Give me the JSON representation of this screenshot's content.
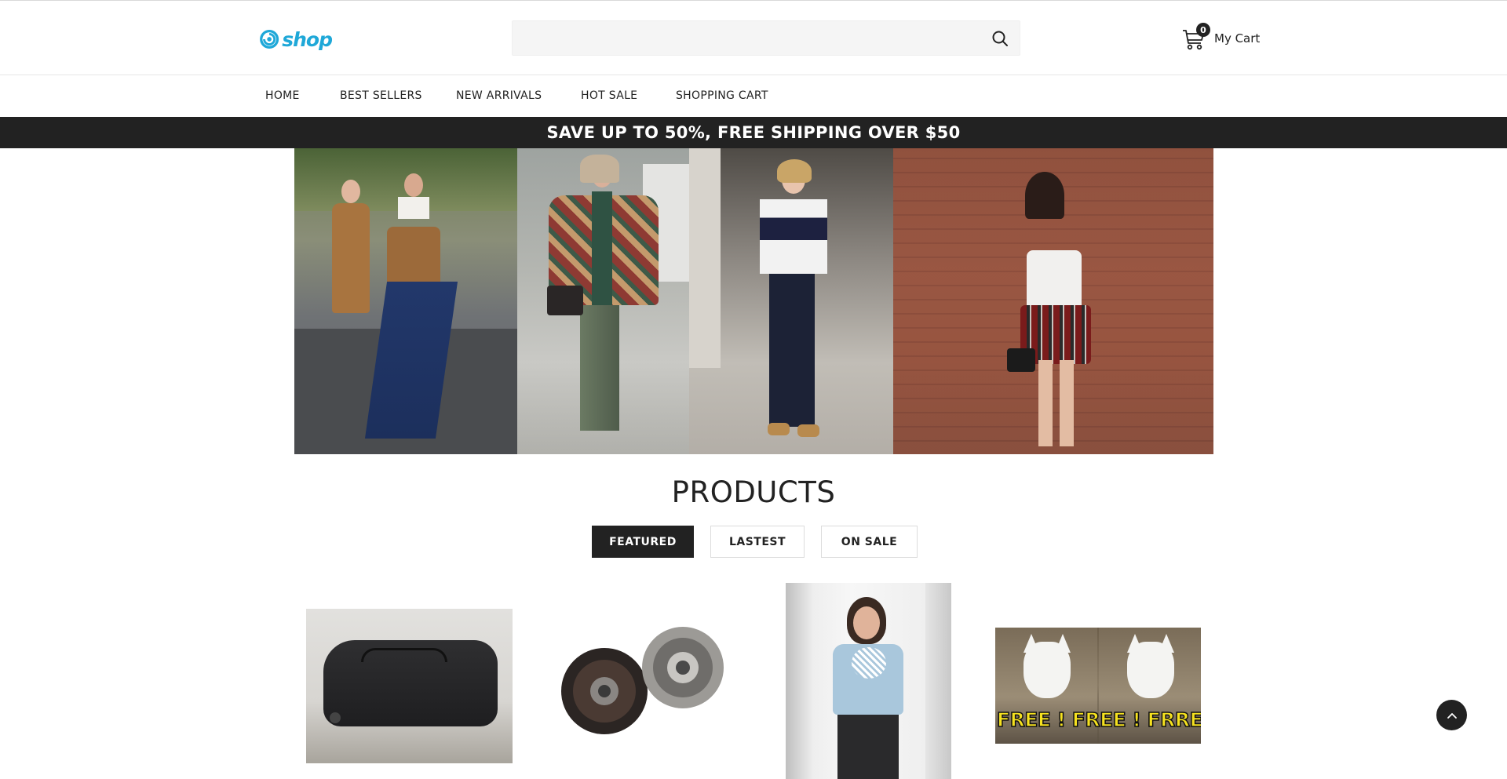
{
  "header": {
    "logo_text": "shop",
    "search": {
      "value": "",
      "placeholder": ""
    },
    "cart": {
      "count": "0",
      "label": "My Cart"
    }
  },
  "nav": {
    "items": [
      "HOME",
      "BEST SELLERS",
      "NEW ARRIVALS",
      "HOT SALE",
      "SHOPPING CART"
    ]
  },
  "promo": {
    "text": "SAVE UP TO 50%, FREE SHIPPING OVER $50"
  },
  "products": {
    "title": "PRODUCTS",
    "tabs": [
      "FEATURED",
      "LASTEST",
      "ON SALE"
    ],
    "active_tab": "FEATURED",
    "items": [
      {
        "image": "black duffel bag"
      },
      {
        "image": "clutch kit"
      },
      {
        "image": "woman in light blue blouse"
      },
      {
        "image": "white puppies",
        "image_text": "FREE ! FREE ! FRRE"
      }
    ]
  },
  "colors": {
    "accent": "#1fa8d8",
    "dark": "#222222",
    "promo_bg": "#222222"
  },
  "icons": [
    "logo-swirl-icon",
    "search-icon",
    "cart-icon",
    "chevron-up-icon"
  ]
}
